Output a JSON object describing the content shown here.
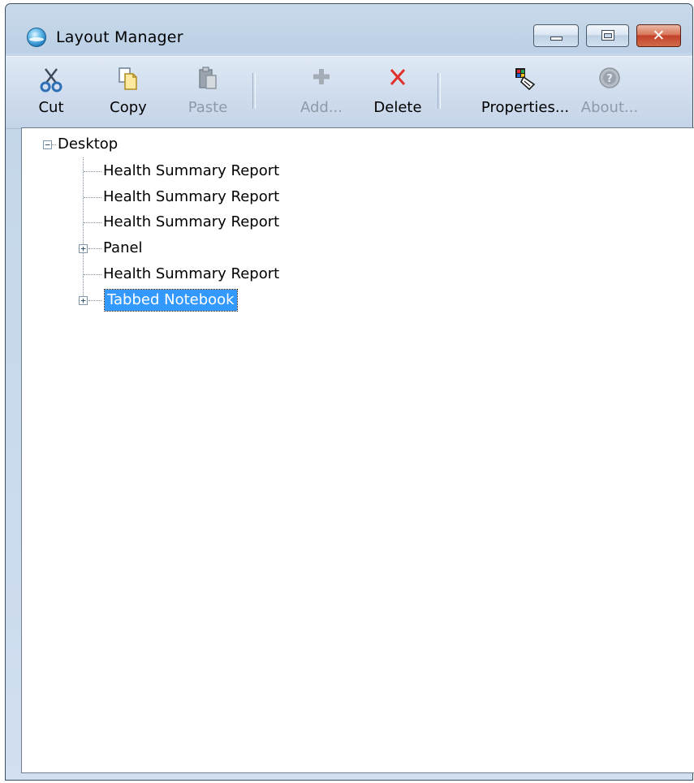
{
  "window": {
    "title": "Layout Manager"
  },
  "window_controls": {
    "minimize": "minimize",
    "maximize": "maximize",
    "close": "✕"
  },
  "toolbar": {
    "cut": "Cut",
    "copy": "Copy",
    "paste": "Paste",
    "add": "Add...",
    "delete": "Delete",
    "properties": "Properties...",
    "about": "About..."
  },
  "tree": {
    "root": {
      "label": "Desktop",
      "expanded": true
    },
    "children": [
      {
        "label": "Health Summary Report",
        "has_children": false,
        "selected": false
      },
      {
        "label": "Health Summary Report",
        "has_children": false,
        "selected": false
      },
      {
        "label": "Health Summary Report",
        "has_children": false,
        "selected": false
      },
      {
        "label": "Panel",
        "has_children": true,
        "selected": false
      },
      {
        "label": "Health Summary Report",
        "has_children": false,
        "selected": false
      },
      {
        "label": "Tabbed Notebook",
        "has_children": true,
        "selected": true
      }
    ]
  },
  "colors": {
    "selection": "#3399ff",
    "delete_icon": "#e0302b",
    "disabled_text": "#8d9aa8"
  }
}
